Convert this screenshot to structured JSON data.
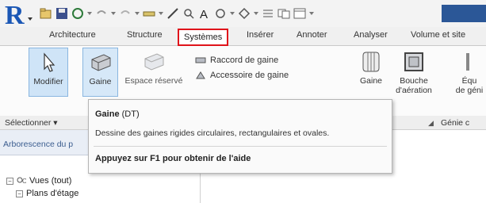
{
  "ribbon_tabs": [
    "Architecture",
    "Structure",
    "Systèmes",
    "Insérer",
    "Annoter",
    "Analyser",
    "Volume et site"
  ],
  "active_tab": "Systèmes",
  "colors": {
    "active_tab_outline": "#e0141b",
    "app_logo": "#1b57b5",
    "selected_button": "#cfe4f7"
  },
  "quick_access_icons": [
    "open-icon",
    "save-icon",
    "sync-icon",
    "undo-icon",
    "redo-icon",
    "measure-icon",
    "dimension-icon",
    "tag-icon",
    "text-icon",
    "3d-view-icon",
    "section-icon",
    "thin-lines-icon",
    "close-windows-icon",
    "switch-windows-icon"
  ],
  "ribbon": {
    "modifier_label": "Modifier",
    "gaine_label": "Gaine",
    "espace_label": "Espace réservé",
    "raccord_label": "Raccord de gaine",
    "accessoire_label": "Accessoire de gaine",
    "gaine_fx_label": "Gaine",
    "bouche_label_1": "Bouche",
    "bouche_label_2": "d'aération",
    "equip_label_1": "Équ",
    "equip_label_2": "de géni",
    "selectionner_label": "Sélectionner ▾",
    "genie_label": "Génie c"
  },
  "tooltip": {
    "title": "Gaine",
    "shortcut": "(DT)",
    "description": "Dessine des gaines rigides circulaires, rectangulaires et ovales.",
    "help": "Appuyez sur F1 pour obtenir de l'aide"
  },
  "browser": {
    "title": "Arborescence du p",
    "tree": [
      {
        "expander": "−",
        "label": "Vues (tout)"
      },
      {
        "expander": "−",
        "label": "Plans d'étage"
      }
    ]
  }
}
